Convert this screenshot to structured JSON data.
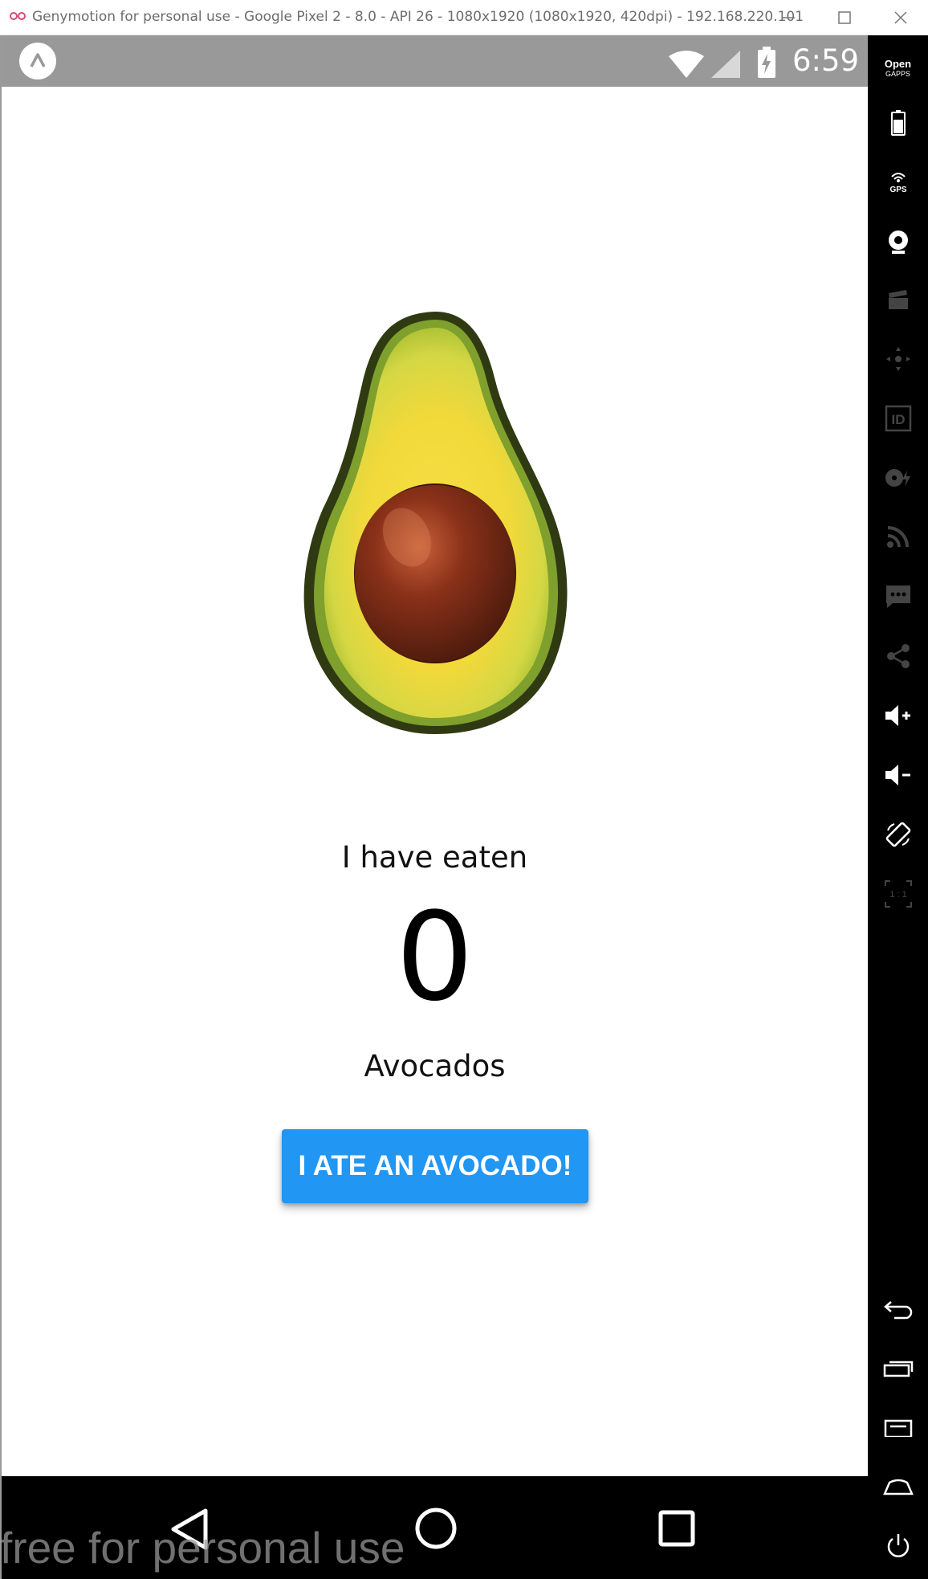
{
  "window": {
    "title": "Genymotion for personal use - Google Pixel 2 - 8.0 - API 26 - 1080x1920 (1080x1920, 420dpi) - 192.168.220.101"
  },
  "statusbar": {
    "time": "6:59",
    "icons": [
      "expo-app-icon",
      "wifi-icon",
      "signal-icon",
      "battery-charging-icon"
    ]
  },
  "main": {
    "image": "avocado-half-icon",
    "eaten_label": "I have eaten",
    "count": "0",
    "unit_label": "Avocados",
    "button_label": "I ATE AN AVOCADO!",
    "button_color": "#2196f3"
  },
  "navbar": {
    "icons": [
      "back-icon",
      "home-icon",
      "recents-icon"
    ]
  },
  "watermark": "free for personal use",
  "sidebar": {
    "opengapps_line1": "Open",
    "opengapps_line2": "GAPPS",
    "gps_label": "GPS",
    "id_label": "ID",
    "pixel_label": "1 : 1",
    "items": [
      "battery-icon",
      "gps-icon",
      "webcam-icon",
      "capture-icon",
      "navigation-icon",
      "device-id-icon",
      "disk-io-icon",
      "network-icon",
      "sms-icon",
      "share-icon",
      "volume-up-icon",
      "volume-down-icon",
      "rotate-icon",
      "pixel-perfect-icon",
      "android-back-icon",
      "android-recents-icon",
      "android-menu-icon",
      "android-home-icon",
      "power-icon"
    ]
  }
}
